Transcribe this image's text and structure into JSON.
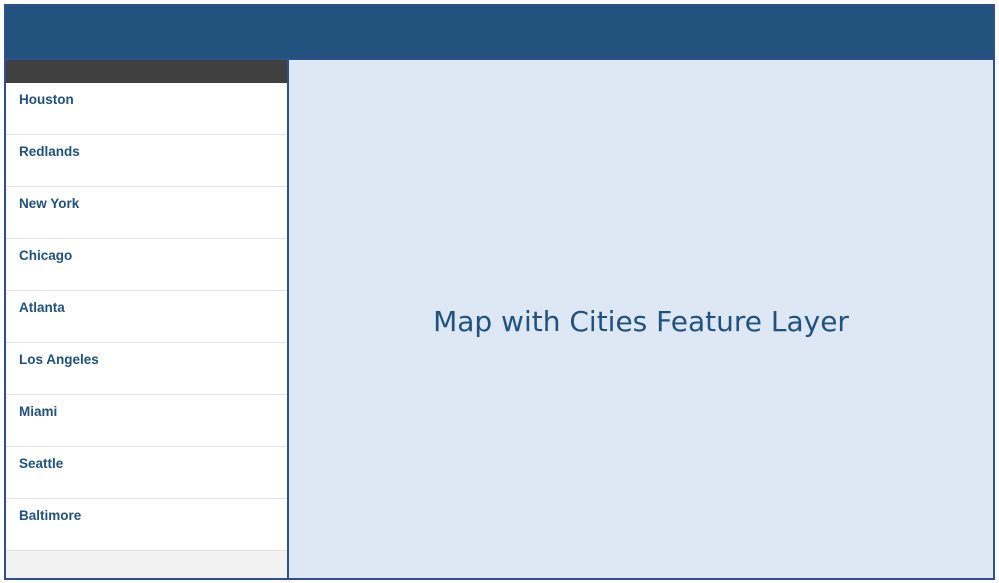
{
  "sidebar": {
    "cities": [
      "Houston",
      "Redlands",
      "New York",
      "Chicago",
      "Atlanta",
      "Los Angeles",
      "Miami",
      "Seattle",
      "Baltimore"
    ]
  },
  "map": {
    "label": "Map with Cities Feature Layer"
  },
  "colors": {
    "header": "#21527d",
    "sidebar_topbar": "#404040",
    "map_background": "#dde8f4",
    "border": "#2f4f8f",
    "text": "#21527d"
  }
}
